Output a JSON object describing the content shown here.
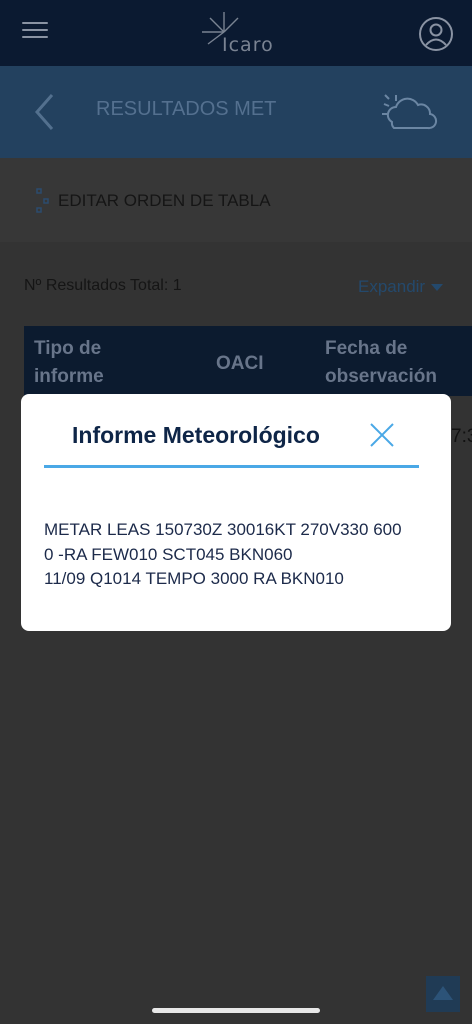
{
  "app": {
    "logo_text": "Icaro"
  },
  "header": {
    "title": "RESULTADOS MET"
  },
  "toolbar": {
    "edit_order_label": "EDITAR ORDEN DE TABLA"
  },
  "results": {
    "count_label": "Nº Resultados Total: 1",
    "expand_label": "Expandir"
  },
  "table": {
    "columns": [
      "Tipo de informe",
      "OACI",
      "Fecha de observación"
    ],
    "row_partial": "7:3"
  },
  "modal": {
    "title": "Informe Meteorológico",
    "body": "METAR LEAS 150730Z 30016KT 270V330 600\n0 -RA FEW010 SCT045 BKN060\n11/09 Q1014 TEMPO 3000 RA BKN010"
  },
  "icons": {
    "menu": "hamburger-menu-icon",
    "user": "user-profile-icon",
    "back": "chevron-left-icon",
    "weather": "sun-cloud-icon",
    "order": "dots-reorder-icon",
    "expand": "caret-down-icon",
    "close": "close-icon",
    "scroll_top": "scroll-to-top-icon"
  },
  "colors": {
    "topbar": "#0b1a31",
    "subbar": "#23415f",
    "overlay_bg": "#333333",
    "modal_title": "#0e2547",
    "accent_rule": "#4aa8e6"
  }
}
